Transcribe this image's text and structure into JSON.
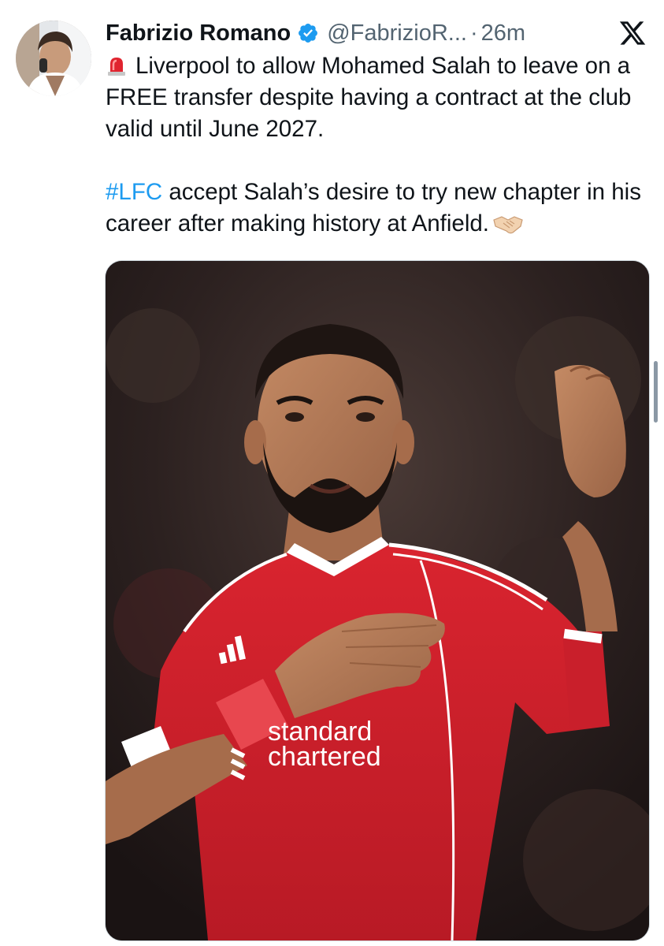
{
  "tweet": {
    "author": {
      "display_name": "Fabrizio Romano",
      "handle": "@FabrizioR...",
      "verified": true,
      "avatar_icon": "avatar-photo"
    },
    "separator": "·",
    "time": "26m",
    "platform_icon": "x-logo-icon",
    "text": {
      "line1_emoji": "siren-emoji",
      "paragraph1": "Liverpool to allow Mohamed Salah to leave on a FREE transfer despite having a contract at the club valid until June 2027.",
      "hashtag": "#LFC",
      "paragraph2": " accept Salah’s desire to try new chapter in his career after making history at Anfield.",
      "line2_emoji": "handshake-emoji"
    },
    "media": {
      "type": "photo",
      "shirt_text_line1": "standard",
      "shirt_text_line2": "chartered"
    }
  },
  "colors": {
    "text": "#0f1419",
    "secondary": "#536471",
    "link": "#1d9bf0",
    "verified": "#1d9bf0",
    "kit_red": "#d0202e"
  }
}
